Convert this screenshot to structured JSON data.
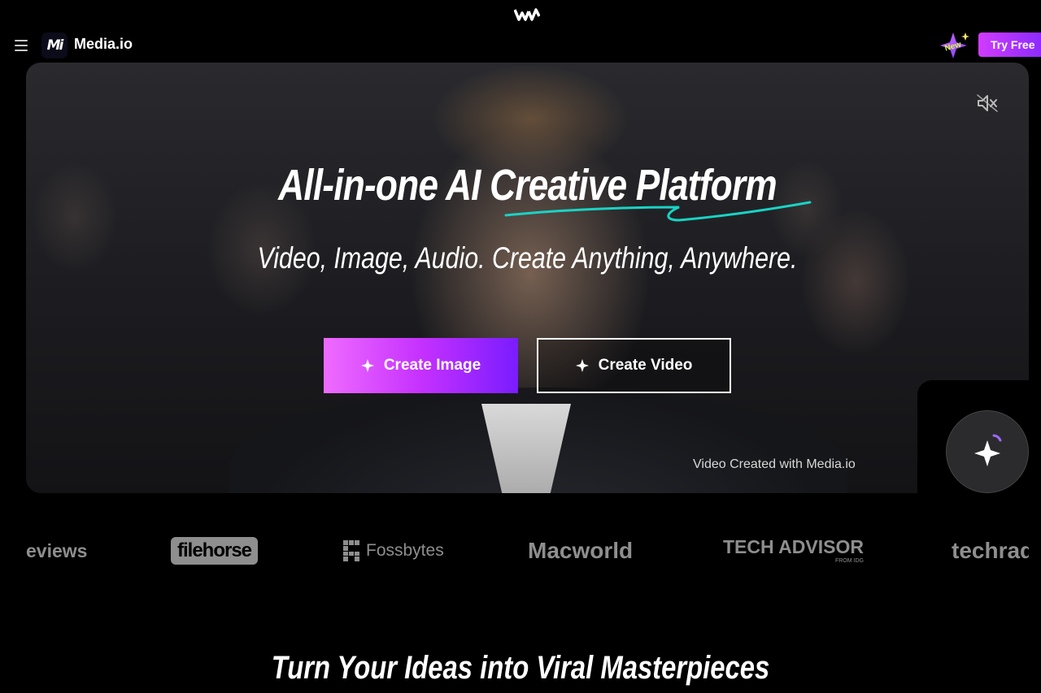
{
  "nav": {
    "brand_mark": "Mi",
    "brand_name": "Media.io",
    "new_badge": "New",
    "try_free": "Try Free"
  },
  "hero": {
    "title": "All-in-one AI Creative Platform",
    "subtitle": "Video, Image, Audio. Create Anything, Anywhere.",
    "create_image": "Create Image",
    "create_video": "Create Video",
    "caption": "Video Created with Media.io"
  },
  "press_logos": [
    "eviews",
    "filehorse",
    "Fossbytes",
    "Macworld",
    "TECH ADVISOR",
    "FROM IDG",
    "techrad"
  ],
  "section": {
    "title": "Turn Your Ideas into Viral Masterpieces"
  },
  "colors": {
    "accent_gradient_start": "#ef6bff",
    "accent_gradient_end": "#7a1cff",
    "try_free_start": "#d13bff",
    "try_free_end": "#8a2bff",
    "scribble": "#19d3c5"
  },
  "icons": [
    "wondershare-logo-icon",
    "menu-icon",
    "new-sparkle-icon",
    "mute-speaker-icon",
    "sparkle-icon",
    "ai-assistant-icon"
  ]
}
